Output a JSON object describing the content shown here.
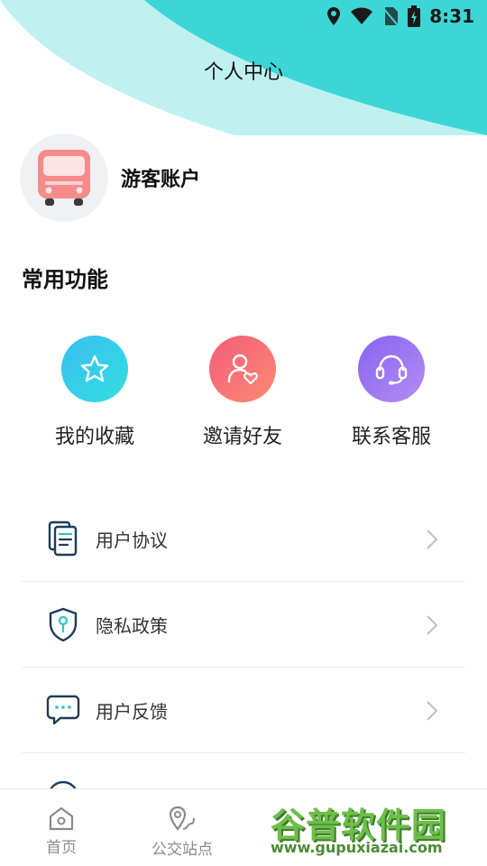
{
  "status_bar": {
    "time": "8:31",
    "icons": [
      "location-icon",
      "wifi-icon",
      "no-sim-icon",
      "battery-charging-icon"
    ]
  },
  "header": {
    "title": "个人中心"
  },
  "profile": {
    "name": "游客账户",
    "avatar_icon": "bus-icon"
  },
  "common_functions": {
    "title": "常用功能",
    "items": [
      {
        "label": "我的收藏",
        "icon": "star-icon",
        "color": "#2ccfe0"
      },
      {
        "label": "邀请好友",
        "icon": "user-heart-icon",
        "color": "#f86c7a"
      },
      {
        "label": "联系客服",
        "icon": "headset-icon",
        "color": "#9a6cf0"
      }
    ]
  },
  "menu": {
    "items": [
      {
        "label": "用户协议",
        "icon": "document-icon"
      },
      {
        "label": "隐私政策",
        "icon": "shield-key-icon"
      },
      {
        "label": "用户反馈",
        "icon": "chat-bubble-icon"
      }
    ]
  },
  "tabbar": {
    "tabs": [
      {
        "label": "首页",
        "icon": "home-icon"
      },
      {
        "label": "公交站点",
        "icon": "map-pin-route-icon"
      }
    ]
  },
  "watermark": {
    "logo": "谷普软件园",
    "url": "www.gupuxiazai.com"
  },
  "colors": {
    "accent": "#3dd6d6",
    "accent_light": "#b8efef",
    "menu_icon": "#1f3b5a",
    "menu_icon_accent": "#2cc5c5"
  }
}
